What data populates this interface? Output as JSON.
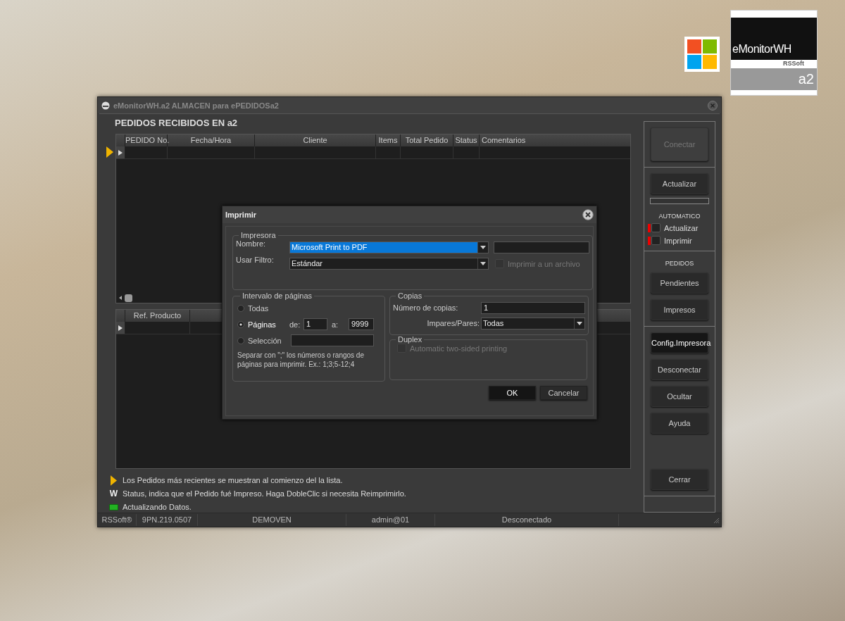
{
  "logo": {
    "brand": "eMonitorWH",
    "maker": "RSSoft",
    "edition": "a2"
  },
  "window": {
    "title": "eMonitorWH.a2 ALMACEN para ePEDIDOSa2"
  },
  "orders": {
    "heading": "PEDIDOS RECIBIDOS EN a2",
    "columns": [
      "PEDIDO No.",
      "Fecha/Hora",
      "Cliente",
      "Items",
      "Total Pedido",
      "Status",
      "Comentarios"
    ]
  },
  "details": {
    "columns": [
      "Ref. Producto"
    ]
  },
  "sidebar": {
    "sections": [
      [
        {
          "kind": "button",
          "label": "Conectar",
          "disabled": true,
          "focused": false
        }
      ],
      [
        {
          "kind": "button",
          "label": "Actualizar",
          "disabled": false,
          "focused": false
        },
        {
          "kind": "progress",
          "level": 0
        },
        {
          "kind": "heading",
          "label": "AUTOMATICO"
        },
        {
          "kind": "checkbox",
          "label": "Actualizar",
          "checked": false
        },
        {
          "kind": "checkbox",
          "label": "Imprimir",
          "checked": false
        }
      ],
      [
        {
          "kind": "heading",
          "label": "PEDIDOS"
        },
        {
          "kind": "button",
          "label": "Pendientes",
          "disabled": false,
          "focused": false
        },
        {
          "kind": "button",
          "label": "Impresos",
          "disabled": false,
          "focused": false
        }
      ],
      [
        {
          "kind": "button",
          "label": "Config.Impresora",
          "disabled": false,
          "focused": true
        },
        {
          "kind": "button",
          "label": "Desconectar",
          "disabled": false,
          "focused": false
        },
        {
          "kind": "button",
          "label": "Ocultar",
          "disabled": false,
          "focused": false
        },
        {
          "kind": "button",
          "label": "Ayuda",
          "disabled": false,
          "focused": false
        },
        {
          "kind": "spacer"
        },
        {
          "kind": "button",
          "label": "Cerrar",
          "disabled": false,
          "focused": false
        }
      ]
    ]
  },
  "legend": [
    {
      "kind": "arrow",
      "text": "Los Pedidos más recientes se muestran al comienzo del la lista."
    },
    {
      "kind": "glyph",
      "glyph": "W",
      "text": "Status, indica que el Pedido fué Impreso. Haga DobleClic si necesita Reimprimirlo."
    },
    {
      "kind": "swatch",
      "text": "Actualizando Datos."
    }
  ],
  "status_bar": [
    "RSSoft®",
    "9PN.219.0507",
    "DEMOVEN",
    "admin@01",
    "Desconectado"
  ],
  "print_dialog": {
    "title": "Imprimir",
    "printer": {
      "legend": "Impresora",
      "name_label": "Nombre:",
      "name_value": "Microsoft Print to PDF",
      "name_highlighted": true,
      "filter_label": "Usar Filtro:",
      "filter_value": "Estándar",
      "to_file": {
        "label": "Imprimir a un archivo",
        "checked": false,
        "disabled": true
      }
    },
    "range": {
      "legend": "Intervalo de páginas",
      "options": [
        {
          "label": "Todas",
          "selected": false
        },
        {
          "label": "Páginas",
          "selected": true
        },
        {
          "label": "Selección",
          "selected": false
        }
      ],
      "from_label": "de:",
      "from_value": "1",
      "to_label": "a:",
      "to_value": "9999",
      "note": "Separar con \";\" los números o rangos de páginas para imprimir. Ex.: 1;3;5-12;4"
    },
    "copies": {
      "legend": "Copias",
      "count_label": "Número de copias:",
      "count_value": "1",
      "parity_label": "Impares/Pares:",
      "parity_value": "Todas"
    },
    "duplex": {
      "legend": "Duplex",
      "option": {
        "label": "Automatic two-sided printing",
        "checked": false,
        "disabled": true
      }
    },
    "buttons": [
      {
        "label": "OK",
        "default": true
      },
      {
        "label": "Cancelar",
        "default": false
      }
    ]
  }
}
